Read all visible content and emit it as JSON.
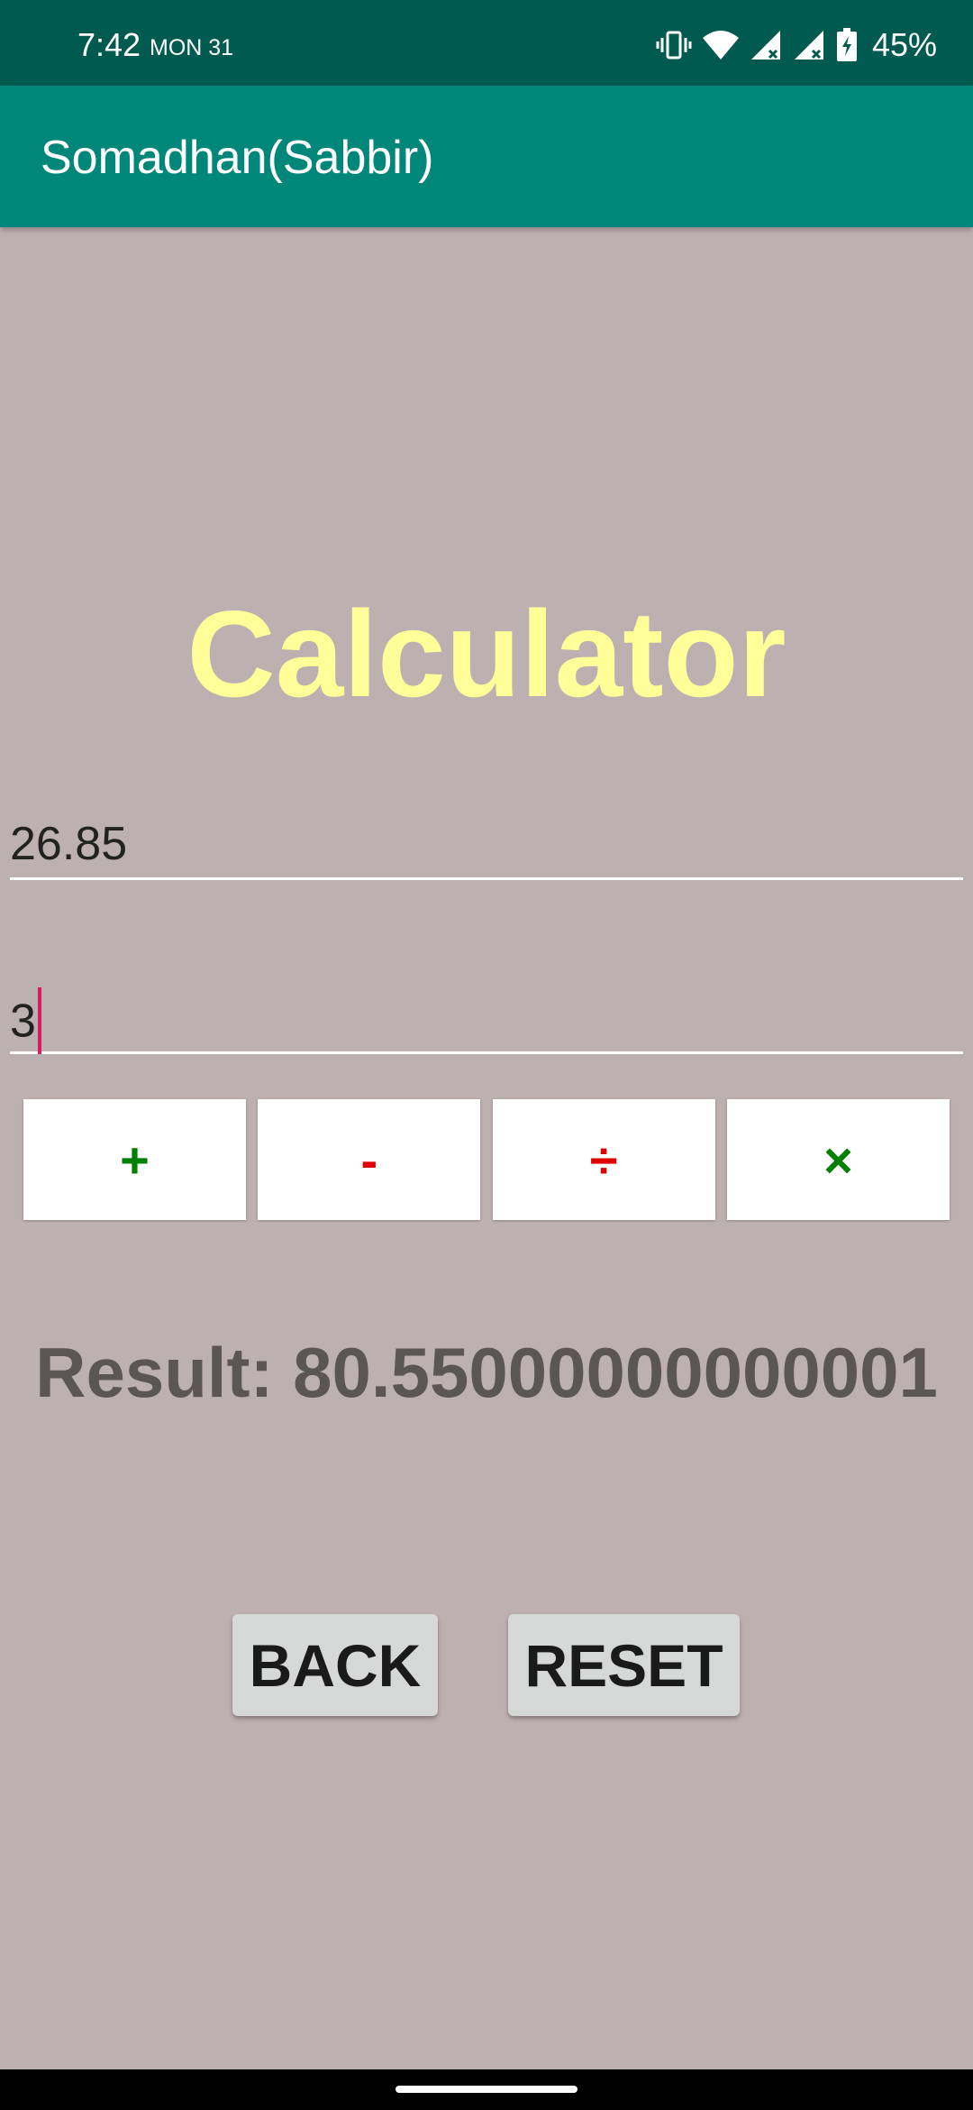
{
  "status_bar": {
    "time": "7:42",
    "day": "MON 31",
    "battery": "45%",
    "icons": [
      "vibrate-icon",
      "wifi-icon",
      "signal-icon",
      "signal-icon",
      "battery-charging-icon"
    ]
  },
  "app_bar": {
    "title": "Somadhan(Sabbir)"
  },
  "heading": "Calculator",
  "inputs": {
    "first_value": "26.85",
    "second_value": "3"
  },
  "operations": {
    "add": "+",
    "subtract": "-",
    "divide": "÷",
    "multiply": "×"
  },
  "result": {
    "text": "Result: 80.55000000000001"
  },
  "actions": {
    "back": "BACK",
    "reset": "RESET"
  },
  "colors": {
    "background": "#bdb0b0",
    "status_bar": "#005a4f",
    "app_bar": "#00877a",
    "heading": "#ffff99",
    "green_op": "#008000",
    "red_op": "#e00000",
    "cursor": "#d81b60",
    "result": "#5b5555"
  }
}
